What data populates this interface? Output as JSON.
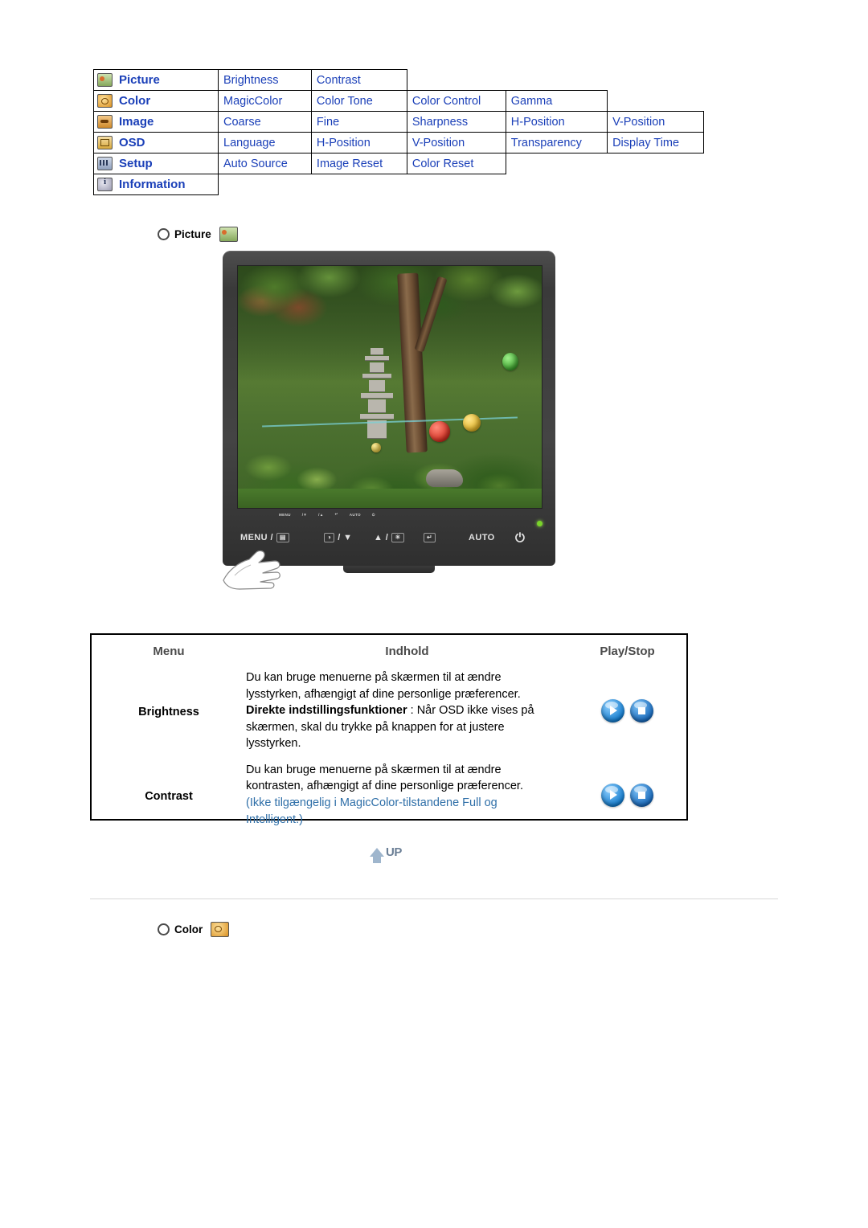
{
  "menu_map": {
    "rows": [
      {
        "icon": "picture-icon",
        "category": "Picture",
        "items": [
          "Brightness",
          "Contrast"
        ]
      },
      {
        "icon": "color-icon",
        "category": "Color",
        "items": [
          "MagicColor",
          "Color Tone",
          "Color Control",
          "Gamma"
        ]
      },
      {
        "icon": "image-icon",
        "category": "Image",
        "items": [
          "Coarse",
          "Fine",
          "Sharpness",
          "H-Position",
          "V-Position"
        ]
      },
      {
        "icon": "osd-icon",
        "category": "OSD",
        "items": [
          "Language",
          "H-Position",
          "V-Position",
          "Transparency",
          "Display Time"
        ]
      },
      {
        "icon": "setup-icon",
        "category": "Setup",
        "items": [
          "Auto Source",
          "Image Reset",
          "Color Reset"
        ]
      },
      {
        "icon": "info-icon",
        "category": "Information",
        "items": []
      }
    ]
  },
  "section_picture": {
    "heading": "Picture",
    "icon": "picture-icon"
  },
  "monitor": {
    "bezel_labels": [
      "MENU",
      "/",
      "AUTO"
    ],
    "controls": [
      {
        "label": "MENU /",
        "glyph": "menu-glyph"
      },
      {
        "label": "/",
        "glyph": "down-glyph"
      },
      {
        "label": "/",
        "glyph": "up-brightness-glyph"
      },
      {
        "label": "",
        "glyph": "enter-glyph"
      },
      {
        "label": "AUTO",
        "glyph": ""
      },
      {
        "label": "",
        "glyph": "power-glyph"
      }
    ]
  },
  "desc_table": {
    "headers": [
      "Menu",
      "Indhold",
      "Play/Stop"
    ],
    "rows": [
      {
        "menu": "Brightness",
        "lines": [
          {
            "text": "Du kan bruge menuerne på skærmen til at ændre",
            "style": "normal"
          },
          {
            "text": "lysstyrken, afhængigt af dine personlige præferencer.",
            "style": "normal"
          },
          {
            "text": "Direkte indstillingsfunktioner",
            "style": "bold",
            "suffix": " : Når OSD ikke vises på"
          },
          {
            "text": "skærmen, skal du trykke på knappen for at justere",
            "style": "normal"
          },
          {
            "text": "lysstyrken.",
            "style": "normal"
          }
        ],
        "controls": [
          "play",
          "stop"
        ]
      },
      {
        "menu": "Contrast",
        "lines": [
          {
            "text": "Du kan bruge menuerne på skærmen til at ændre",
            "style": "normal"
          },
          {
            "text": "kontrasten, afhængigt af dine personlige præferencer.",
            "style": "normal"
          },
          {
            "text": "(Ikke tilgængelig i MagicColor-tilstandene Full og",
            "style": "blue"
          },
          {
            "text": "Intelligent.)",
            "style": "blue"
          }
        ],
        "controls": [
          "play",
          "stop"
        ]
      }
    ]
  },
  "up_button": {
    "label": "UP"
  },
  "section_color": {
    "heading": "Color",
    "icon": "color-icon"
  },
  "colors": {
    "link_blue": "#1a3fb8",
    "note_blue": "#2f6fa8",
    "header_gray": "#4a4a4a"
  }
}
